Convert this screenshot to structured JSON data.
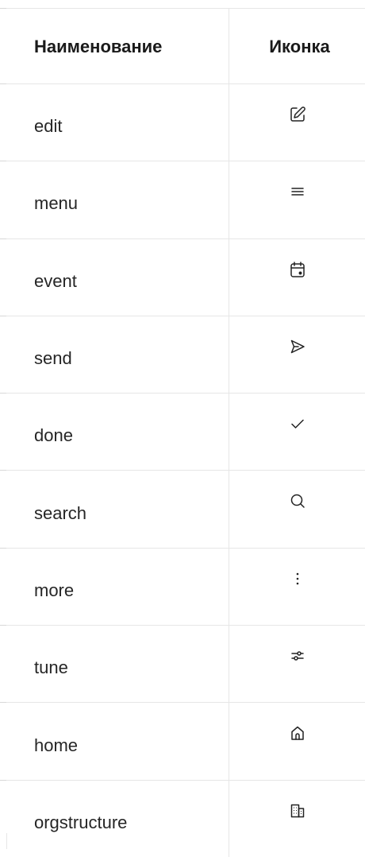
{
  "table": {
    "headers": {
      "name": "Наименование",
      "icon": "Иконка"
    },
    "rows": [
      {
        "name": "edit",
        "icon": "edit-icon"
      },
      {
        "name": "menu",
        "icon": "menu-icon"
      },
      {
        "name": "event",
        "icon": "event-icon"
      },
      {
        "name": "send",
        "icon": "send-icon"
      },
      {
        "name": "done",
        "icon": "done-icon"
      },
      {
        "name": "search",
        "icon": "search-icon"
      },
      {
        "name": "more",
        "icon": "more-icon"
      },
      {
        "name": "tune",
        "icon": "tune-icon"
      },
      {
        "name": "home",
        "icon": "home-icon"
      },
      {
        "name": "orgstructure",
        "icon": "orgstructure-icon"
      }
    ]
  }
}
